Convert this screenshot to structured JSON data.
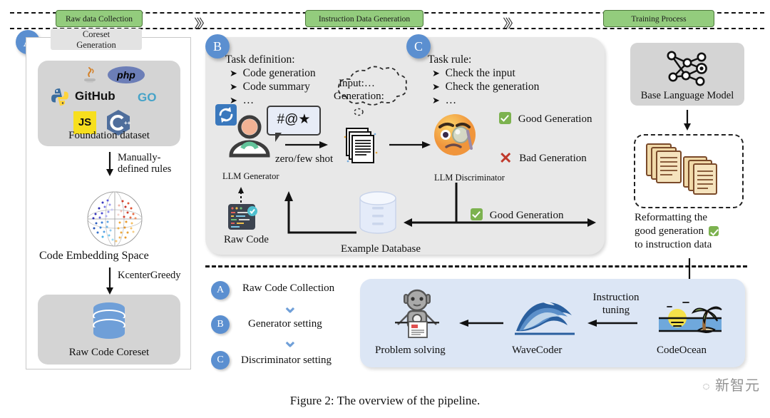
{
  "figure": {
    "caption": "Figure 2: The overview of the pipeline.",
    "watermark": "新智元"
  },
  "banner": {
    "phases": [
      {
        "label": "Raw data Collection"
      },
      {
        "label": "Instruction Data Generation"
      },
      {
        "label": "Training Process"
      }
    ],
    "chevron": "〉〉〉"
  },
  "panel_a": {
    "badge": "A",
    "tab_line1": "Coreset",
    "tab_line2": "Generation",
    "foundation": {
      "caption": "Foundation dataset",
      "logos": [
        "java-icon",
        "php-icon",
        "python-icon",
        "github-icon",
        "go-icon",
        "javascript-icon",
        "cplusplus-icon"
      ],
      "github_label": "GitHub",
      "go_label": "GO",
      "js_label": "JS",
      "php_label": "php"
    },
    "arrow1_label_line1": "Manually-",
    "arrow1_label_line2": "defined rules",
    "embedding_caption": "Code Embedding Space",
    "arrow2_label": "KcenterGreedy",
    "coreset_caption": "Raw Code Coreset"
  },
  "panel_b": {
    "badge": "B",
    "task_definition_title": "Task definition:",
    "task_definition_items": [
      "Code generation",
      "Code summary",
      "…"
    ],
    "cloud_line1": "Input:…",
    "cloud_line2": "Generation:",
    "speech_symbols": "#@★",
    "generator_label": "LLM Generator",
    "shot_label": "zero/few shot",
    "raw_code_label": "Raw Code",
    "example_db_label": "Example Database",
    "feedback_label": "Good Generation",
    "refresh_icon": "refresh-icon"
  },
  "panel_c": {
    "badge": "C",
    "task_rule_title": "Task rule:",
    "task_rule_items": [
      "Check the input",
      "Check the generation",
      "…"
    ],
    "discriminator_label": "LLM Discriminator",
    "good_label": "Good Generation",
    "bad_label": "Bad Generation",
    "emoji": "face-with-monocle-icon"
  },
  "training": {
    "base_model_label": "Base Language Model",
    "base_model_icon": "neural-network-icon",
    "reformat_line1": "Reformatting the",
    "reformat_line2": "good generation",
    "reformat_line3": "to instruction data",
    "documents_icon": "stacked-documents-icon"
  },
  "legend": {
    "items": [
      {
        "badge": "A",
        "label": "Raw Code Collection"
      },
      {
        "badge": "B",
        "label": "Generator setting"
      },
      {
        "badge": "C",
        "label": "Discriminator setting"
      }
    ]
  },
  "pipeline": {
    "problem_solving_label": "Problem solving",
    "problem_solving_icon": "robot-icon",
    "wavecoder_label": "WaveCoder",
    "wavecoder_icon": "wave-icon",
    "codeocean_label": "CodeOcean",
    "codeocean_icon": "beach-icon",
    "instruction_tuning_line1": "Instruction",
    "instruction_tuning_line2": "tuning"
  },
  "colors": {
    "phase_green": "#93cc7d",
    "badge_blue": "#5b8fd0",
    "panel_gray": "#e8e8e8",
    "box_gray": "#d4d4d4",
    "blue_box": "#dce6f5",
    "check_green": "#7cb24f",
    "x_red": "#c0392b"
  }
}
